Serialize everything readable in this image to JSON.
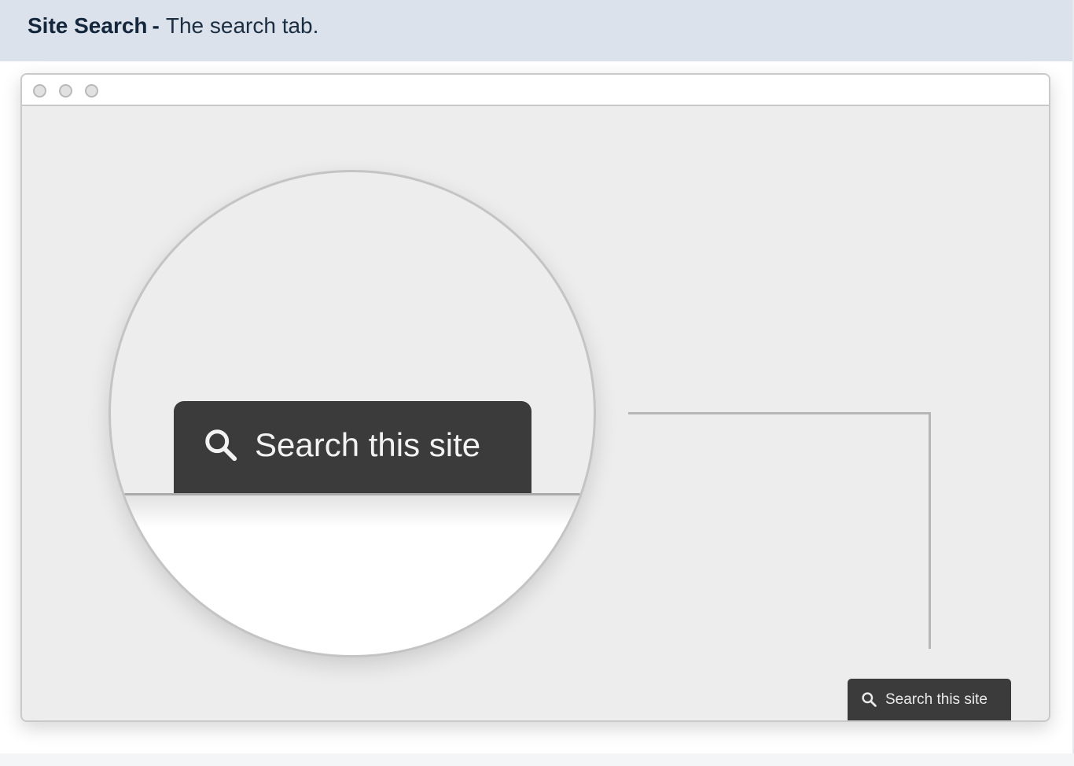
{
  "caption": {
    "title": "Site Search",
    "separator": "-",
    "description": "The search tab."
  },
  "browser": {
    "window_controls": [
      "window-dot-1",
      "window-dot-2",
      "window-dot-3"
    ]
  },
  "magnified_tab": {
    "icon": "search-icon",
    "label": "Search this site"
  },
  "search_tab": {
    "icon": "search-icon",
    "label": "Search this site"
  },
  "colors": {
    "caption_bg": "#dbe2eb",
    "caption_text": "#13263b",
    "tab_bg": "#3b3b3b",
    "tab_text": "#f2f2f2",
    "page_bg": "#ededed"
  }
}
